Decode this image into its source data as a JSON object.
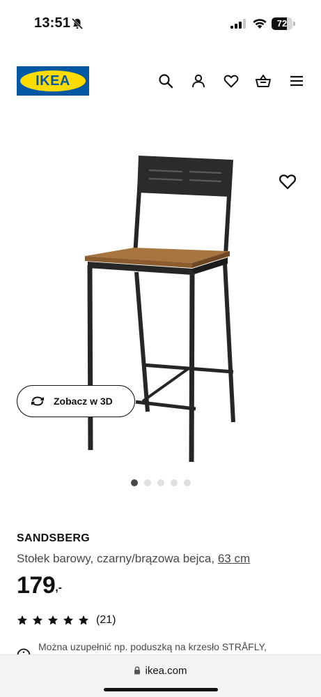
{
  "status_bar": {
    "time": "13:51",
    "battery_level": "72",
    "battery_fraction": 0.72,
    "icons": [
      "bell-slash-icon",
      "signal-icon",
      "wifi-icon",
      "battery-icon"
    ]
  },
  "header": {
    "logo_text": "IKEA",
    "icons": [
      "search-icon",
      "user-icon",
      "heart-icon",
      "basket-icon",
      "menu-icon"
    ]
  },
  "product": {
    "name": "SANDSBERG",
    "description": "Stołek barowy, czarny/brązowa bejca, ",
    "size": "63 cm",
    "price": "179",
    "price_suffix": ",-",
    "rating_stars": 5,
    "rating_count": "(21)",
    "note": "Można uzupełnić np. poduszką na krzesło STRÅFLY,"
  },
  "gallery": {
    "view3d_label": "Zobacz w 3D",
    "image_count": 5,
    "active_index": 0
  },
  "browser": {
    "url": "ikea.com"
  },
  "colors": {
    "ikea_blue": "#0058a3",
    "ikea_yellow": "#ffdb00",
    "text_primary": "#111111",
    "text_secondary": "#484848",
    "seat_brown": "#a8743f",
    "frame_black": "#262626"
  }
}
